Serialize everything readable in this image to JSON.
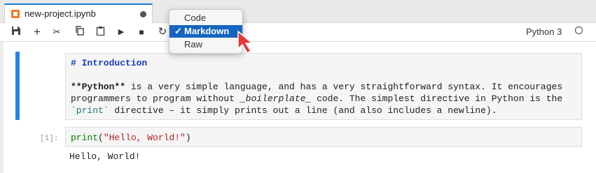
{
  "tab": {
    "title": "new-project.ipynb"
  },
  "toolbar": {
    "buttons": [
      "save",
      "add-cell",
      "cut",
      "copy",
      "paste",
      "run",
      "stop",
      "restart"
    ],
    "kernel_name": "Python 3"
  },
  "cell_type_menu": {
    "options": [
      "Code",
      "Markdown",
      "Raw"
    ],
    "selected": "Markdown",
    "check": "✓"
  },
  "markdown_cell": {
    "heading": "# Introduction",
    "line1_bold": "**Python**",
    "line1_rest": " is a very simple language, and has a very straightforward syntax. It encourages",
    "line2_pre": "programmers to program without ",
    "line2_italic": "_boilerplate_",
    "line2_post": " code. The simplest directive in Python is the",
    "line3_code": "`print`",
    "line3_rest": " directive – it simply prints out a line (and also includes a newline)."
  },
  "code_cell": {
    "prompt": "[1]:",
    "fn": "print",
    "open": "(",
    "arg": "\"Hello, World!\"",
    "close": ")",
    "output": "Hello, World!"
  },
  "colors": {
    "accent": "#1e88e5",
    "menu_selected": "#1565c0",
    "notebook_icon": "#f37726",
    "pointer": "#e53935"
  }
}
